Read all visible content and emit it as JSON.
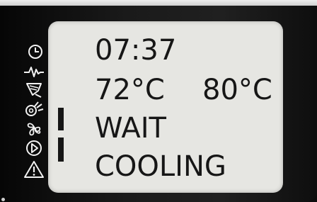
{
  "display": {
    "time": "07:37",
    "temp_current": "72°C",
    "temp_target": "80°C",
    "status": "WAIT",
    "mode": "COOLING"
  },
  "indicators": [
    {
      "name": "clock-icon"
    },
    {
      "name": "heartbeat-icon"
    },
    {
      "name": "heater-icon"
    },
    {
      "name": "pump-icon"
    },
    {
      "name": "fan-icon"
    },
    {
      "name": "play-icon"
    },
    {
      "name": "warning-icon"
    }
  ],
  "colors": {
    "lcd_background": "#e6e6e2",
    "lcd_text": "#161616",
    "icon_color": "#f2f2f2",
    "bezel": "#1a1a1a"
  }
}
